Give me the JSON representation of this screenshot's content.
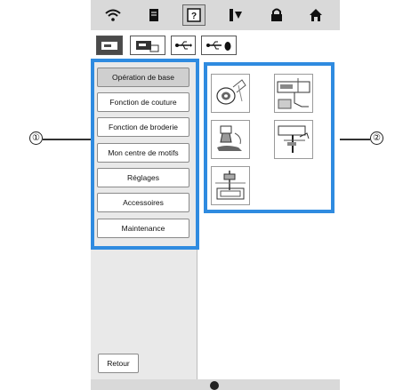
{
  "menu": {
    "items": [
      {
        "label": "Opération de base",
        "selected": true
      },
      {
        "label": "Fonction de couture",
        "selected": false
      },
      {
        "label": "Fonction de broderie",
        "selected": false
      },
      {
        "label": "Mon centre de motifs",
        "selected": false
      },
      {
        "label": "Réglages",
        "selected": false
      },
      {
        "label": "Accessoires",
        "selected": false
      },
      {
        "label": "Maintenance",
        "selected": false
      }
    ]
  },
  "footer": {
    "back_label": "Retour"
  },
  "callouts": {
    "left": "①",
    "right": "②"
  },
  "colors": {
    "highlight": "#2f8be0",
    "bar": "#d9d9d9"
  }
}
